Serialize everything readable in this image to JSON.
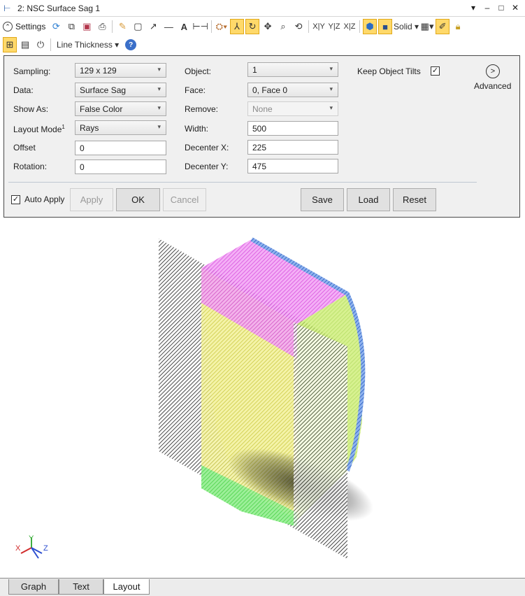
{
  "window": {
    "title": "2: NSC Surface Sag 1",
    "controls": [
      "▾",
      "–",
      "□",
      "✕"
    ]
  },
  "toolbar": {
    "settings_label": "Settings",
    "line_thickness_label": "Line Thickness",
    "xy_label": "X|Y",
    "yz_label": "Y|Z",
    "xz_label": "X|Z",
    "solid_label": "Solid",
    "text_tool": "A",
    "dim_tool": "⊢⊣"
  },
  "settings": {
    "sampling": {
      "label": "Sampling:",
      "value": "129 x 129"
    },
    "data": {
      "label": "Data:",
      "value": "Surface Sag"
    },
    "show_as": {
      "label": "Show As:",
      "value": "False Color"
    },
    "layout_mode": {
      "label": "Layout Mode",
      "superscript": "1",
      "value": "Rays"
    },
    "offset": {
      "label": "Offset",
      "value": "0"
    },
    "rotation": {
      "label": "Rotation:",
      "value": "0"
    },
    "object": {
      "label": "Object:",
      "value": "1"
    },
    "face": {
      "label": "Face:",
      "value": "0, Face 0"
    },
    "remove": {
      "label": "Remove:",
      "value": "None"
    },
    "width": {
      "label": "Width:",
      "value": "500"
    },
    "decenter_x": {
      "label": "Decenter X:",
      "value": "225"
    },
    "decenter_y": {
      "label": "Decenter Y:",
      "value": "475"
    },
    "keep_object_tilts": {
      "label": "Keep Object Tilts",
      "checked": true
    },
    "advanced_label": "Advanced",
    "auto_apply": {
      "label": "Auto Apply",
      "checked": true
    },
    "buttons": {
      "apply": "Apply",
      "ok": "OK",
      "cancel": "Cancel",
      "save": "Save",
      "load": "Load",
      "reset": "Reset"
    }
  },
  "axes_triad": {
    "x": "X",
    "y": "Y",
    "z": "Z"
  },
  "tabs": [
    {
      "label": "Graph",
      "active": false
    },
    {
      "label": "Text",
      "active": false
    },
    {
      "label": "Layout",
      "active": true
    }
  ],
  "colors": {
    "magenta": "#e35ee8",
    "yellow": "#e9e657",
    "green": "#6ee46b",
    "blue": "#3a6ed0",
    "active_tool": "#ffd96a"
  }
}
